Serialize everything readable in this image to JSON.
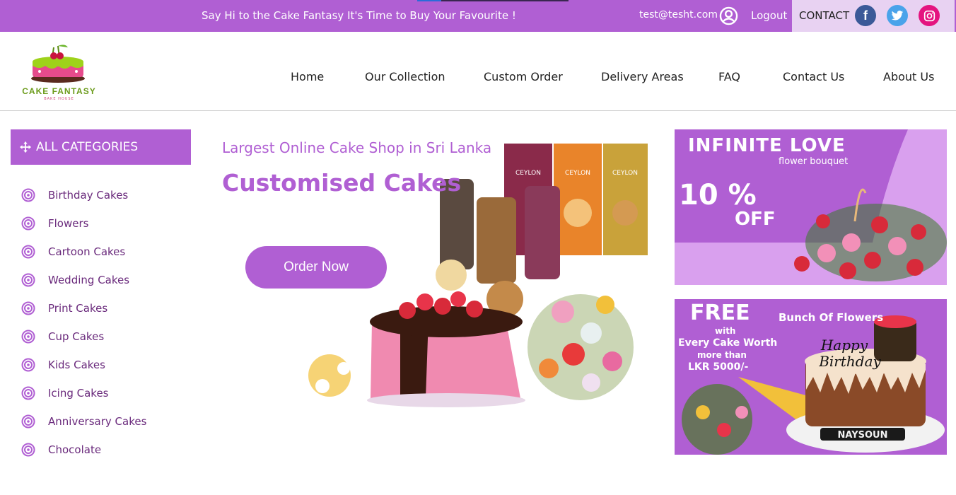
{
  "topbar": {
    "promo": "Say Hi to the Cake Fantasy It's Time to Buy Your Favourite !",
    "email": "test@tesht.com",
    "logout": "Logout",
    "contact": "CONTACT",
    "progress": 0.16,
    "social": {
      "facebook": "f",
      "twitter": "twitter-icon",
      "instagram": "instagram-icon"
    }
  },
  "logo": {
    "name": "CAKE FANTASY",
    "tagline": "BAKE HOUSE"
  },
  "nav": [
    "Home",
    "Our Collection",
    "Custom Order",
    "Delivery Areas",
    "FAQ",
    "Contact Us",
    "About Us"
  ],
  "sidebar": {
    "title": "ALL CATEGORIES",
    "items": [
      "Birthday Cakes",
      "Flowers",
      "Cartoon Cakes",
      "Wedding Cakes",
      "Print Cakes",
      "Cup Cakes",
      "Kids Cakes",
      "Icing Cakes",
      "Anniversary Cakes",
      "Chocolate"
    ]
  },
  "hero": {
    "subtitle": "Largest Online Cake Shop in Sri Lanka",
    "title": "Customised Cakes",
    "button": "Order Now",
    "products": [
      "CEYLON",
      "CEYLON",
      "CEYLON"
    ]
  },
  "banners": {
    "love": {
      "title": "INFINITE LOVE",
      "subtitle": "flower bouquet",
      "discount": "10 %",
      "off": "OFF"
    },
    "free": {
      "title": "FREE",
      "bunch": "Bunch Of Flowers",
      "with": "with",
      "every": "Every Cake Worth",
      "more": "more than",
      "amount": "LKR 5000/-"
    }
  },
  "colors": {
    "accent": "#b05fd3",
    "light": "#e8d2f2",
    "text": "#6a2a7c"
  }
}
